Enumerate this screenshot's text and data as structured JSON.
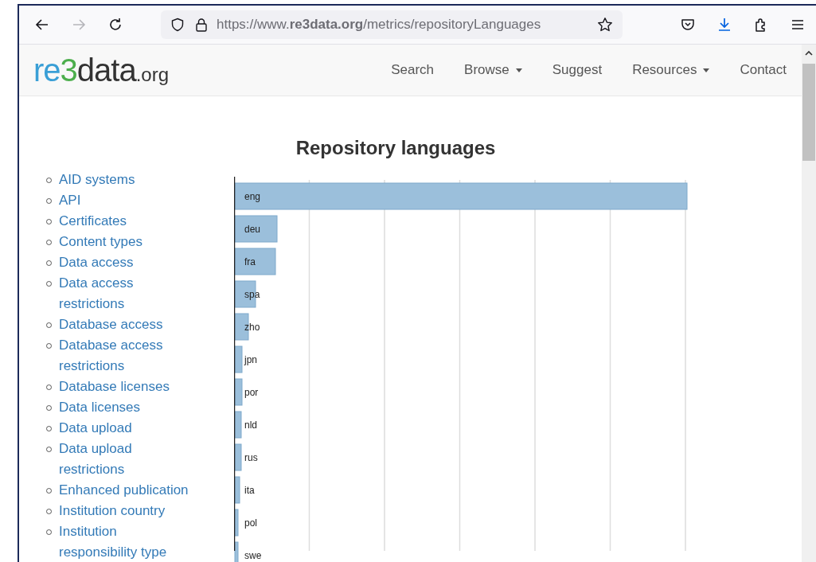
{
  "browser": {
    "url": "https://www.**re3data.org**/metrics/repositoryLanguages",
    "forward_disabled": true
  },
  "site_header": {
    "logo": [
      {
        "text": "re",
        "color": "#3a9fd6",
        "kind": "main"
      },
      {
        "text": "3",
        "color": "#4cae4c",
        "kind": "main"
      },
      {
        "text": "data",
        "color": "#333333",
        "kind": "main"
      },
      {
        "text": ".org",
        "color": "#333333",
        "kind": "suffix"
      }
    ],
    "nav": [
      {
        "label": "Search",
        "dropdown": false
      },
      {
        "label": "Browse",
        "dropdown": true
      },
      {
        "label": "Suggest",
        "dropdown": false
      },
      {
        "label": "Resources",
        "dropdown": true
      },
      {
        "label": "Contact",
        "dropdown": false
      }
    ]
  },
  "page": {
    "title": "Repository languages",
    "sidebar": [
      "AID systems",
      "API",
      "Certificates",
      "Content types",
      "Data access",
      "Data access restrictions",
      "Database access",
      "Database access restrictions",
      "Database licenses",
      "Data licenses",
      "Data upload",
      "Data upload restrictions",
      "Enhanced publication",
      "Institution country",
      "Institution responsibility type"
    ],
    "chart": {
      "bar_labels": [
        "eng",
        "deu",
        "fra",
        "spa",
        "zho",
        "jpn",
        "por",
        "nld",
        "rus",
        "ita",
        "pol",
        "swe"
      ]
    }
  }
}
